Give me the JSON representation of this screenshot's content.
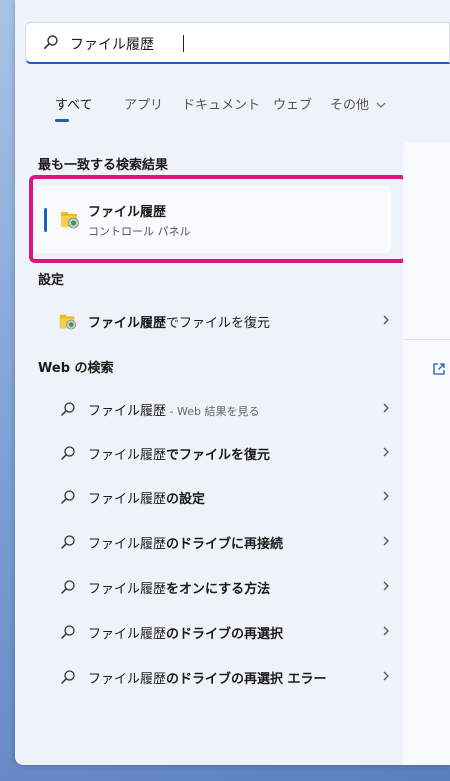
{
  "search": {
    "value": "ファイル履歴"
  },
  "tabs": [
    {
      "label": "すべて",
      "active": true
    },
    {
      "label": "アプリ",
      "active": false
    },
    {
      "label": "ドキュメント",
      "active": false
    },
    {
      "label": "ウェブ",
      "active": false
    },
    {
      "label": "その他",
      "active": false
    }
  ],
  "sections": {
    "best_match": "最も一致する検索結果",
    "settings": "設定",
    "web": "Web の検索"
  },
  "best_match": {
    "title": "ファイル履歴",
    "subtitle": "コントロール パネル"
  },
  "settings_item": {
    "bold": "ファイル履歴",
    "rest": "でファイルを復元"
  },
  "web_items": [
    {
      "bold": "ファイル履歴",
      "rest": "",
      "sub": " - Web 結果を見る"
    },
    {
      "bold": "ファイル履歴",
      "rest": "でファイルを復元",
      "sub": ""
    },
    {
      "bold": "ファイル履歴",
      "rest": "の設定",
      "sub": ""
    },
    {
      "bold": "ファイル履歴",
      "rest": "のドライブに再接続",
      "sub": ""
    },
    {
      "bold": "ファイル履歴",
      "rest": "をオンにする方法",
      "sub": ""
    },
    {
      "bold": "ファイル履歴",
      "rest": "のドライブの再選択",
      "sub": ""
    },
    {
      "bold": "ファイル履歴",
      "rest": "のドライブの再選択 エラー",
      "sub": ""
    }
  ],
  "colors": {
    "accent": "#1f5fbf",
    "highlight": "#d4197f"
  }
}
